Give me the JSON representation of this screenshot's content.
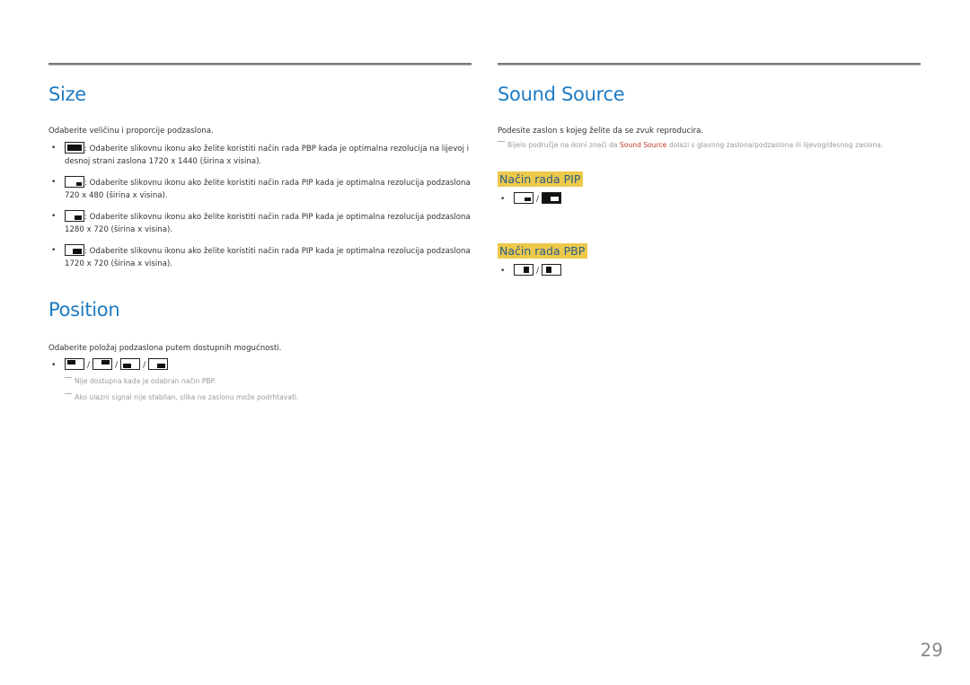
{
  "page_number": "29",
  "colors": {
    "heading": "#1e7bc2",
    "highlight_bg": "#ecc94b",
    "highlight_text": "#2b5d8a",
    "emphasis_red": "#c0392b",
    "note_gray": "#9a9a9a"
  },
  "size": {
    "title": "Size",
    "intro": "Odaberite veličinu i proporcije podzaslona.",
    "items": [
      {
        "icon": "pbp-split-icon",
        "text": ": Odaberite slikovnu ikonu ako želite koristiti način rada PBP kada je optimalna rezolucija na lijevoj i desnoj strani zaslona 1720 x 1440 (širina x visina)."
      },
      {
        "icon": "pip-small-icon",
        "text": ": Odaberite slikovnu ikonu ako želite koristiti način rada PIP kada je optimalna rezolucija podzaslona 720 x 480 (širina x visina)."
      },
      {
        "icon": "pip-medium-icon",
        "text": ": Odaberite slikovnu ikonu ako želite koristiti način rada PIP kada je optimalna rezolucija podzaslona 1280 x 720 (širina x visina)."
      },
      {
        "icon": "pip-large-icon",
        "text": ": Odaberite slikovnu ikonu ako želite koristiti način rada PIP kada je optimalna rezolucija podzaslona 1720 x 720 (širina x visina)."
      }
    ]
  },
  "position": {
    "title": "Position",
    "intro": "Odaberite položaj podzaslona putem dostupnih mogućnosti.",
    "separator": "/",
    "icons": [
      "top-left-position-icon",
      "top-right-position-icon",
      "bottom-left-position-icon",
      "bottom-right-position-icon"
    ],
    "notes": [
      "Nije dostupna kada je odabran način PBP.",
      "Ako ulazni signal nije stabilan, slika na zaslonu može podrhtavati."
    ]
  },
  "sound_source": {
    "title": "Sound Source",
    "intro": "Podesite zaslon s kojeg želite da se zvuk reproducira.",
    "note_before": "Bijelo područje na ikoni znači da ",
    "note_highlight": "Sound Source",
    "note_after": " dolazi s glavnog zaslona/podzaslona ili lijevog/desnog zaslona.",
    "separator": "/",
    "pip_heading": "Način rada PIP",
    "pip_icons": [
      "pip-sub-sound-icon",
      "pip-main-sound-icon"
    ],
    "pbp_heading": "Način rada PBP",
    "pbp_icons": [
      "pbp-left-sound-icon",
      "pbp-right-sound-icon"
    ]
  }
}
